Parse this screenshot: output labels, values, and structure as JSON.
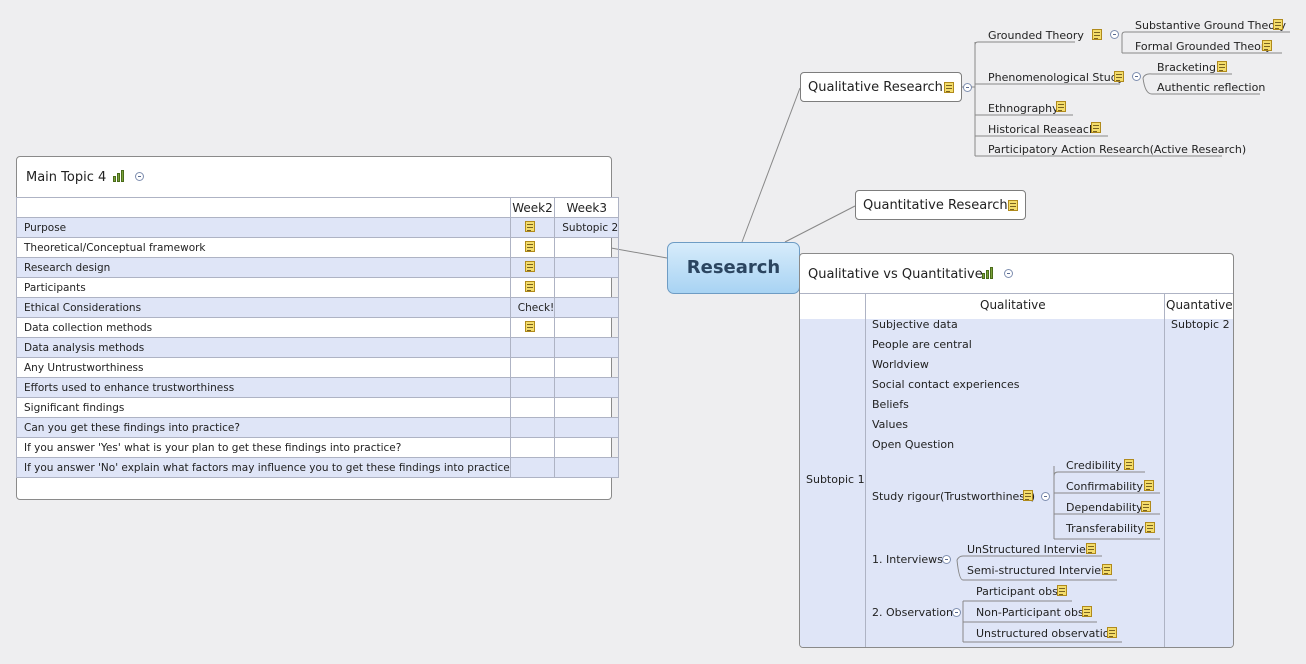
{
  "central": "Research",
  "qualitative_research": {
    "title": "Qualitative Research",
    "children": [
      {
        "label": "Grounded Theory",
        "children": [
          "Substantive Ground Theory",
          "Formal Grounded Theory"
        ]
      },
      {
        "label": "Phenomenological Study",
        "children": [
          "Bracketing",
          "Authentic reflection"
        ]
      },
      {
        "label": "Ethnography"
      },
      {
        "label": "Historical Reaseach"
      },
      {
        "label": "Participatory Action Research(Active Research)"
      }
    ]
  },
  "quantitative_research": {
    "title": "Quantitative Research"
  },
  "main_topic_4": {
    "title": "Main Topic 4",
    "columns": [
      "Week2",
      "Week3"
    ],
    "rows": [
      {
        "label": "Purpose",
        "week2": "",
        "week3": "Subtopic 2"
      },
      {
        "label": "Theoretical/Conceptual framework",
        "week2": "",
        "week3": ""
      },
      {
        "label": "Research design",
        "week2": "",
        "week3": ""
      },
      {
        "label": "Participants",
        "week2": "",
        "week3": ""
      },
      {
        "label": "Ethical Considerations",
        "week2": "Check!",
        "week3": ""
      },
      {
        "label": "Data collection methods",
        "week2": "",
        "week3": ""
      },
      {
        "label": "Data analysis methods",
        "week2": "",
        "week3": ""
      },
      {
        "label": "Any Untrustworthiness",
        "week2": "",
        "week3": ""
      },
      {
        "label": "Efforts used to enhance trustworthiness",
        "week2": "",
        "week3": ""
      },
      {
        "label": "Significant findings",
        "week2": "",
        "week3": ""
      },
      {
        "label": "Can you get these findings into practice?",
        "week2": "",
        "week3": ""
      },
      {
        "label": "If you answer 'Yes' what is your plan to get these findings into practice?",
        "week2": "",
        "week3": ""
      },
      {
        "label": "If you answer 'No' explain what factors may influence you to get these findings into practice",
        "week2": "",
        "week3": ""
      }
    ]
  },
  "qual_vs_quant": {
    "title": "Qualitative vs Quantitative",
    "columns": [
      "Qualitative",
      "Quantative"
    ],
    "row_label": "Subtopic 1",
    "quant_cell": "Subtopic 2",
    "items": [
      "Subjective data",
      "People are central",
      "Worldview",
      "Social contact experiences",
      "Beliefs",
      "Values",
      "Open Question"
    ],
    "rigour": {
      "label": "Study rigour(Trustworthiness)",
      "children": [
        "Credibility",
        "Confirmability",
        "Dependability",
        "Transferability"
      ]
    },
    "interviews": {
      "label": "1. Interviews",
      "children": [
        "UnStructured Interview",
        "Semi-structured Interview"
      ]
    },
    "observation": {
      "label": "2. Observation",
      "children": [
        "Participant obs",
        "Non-Participant obs",
        "Unstructured observation"
      ]
    }
  }
}
